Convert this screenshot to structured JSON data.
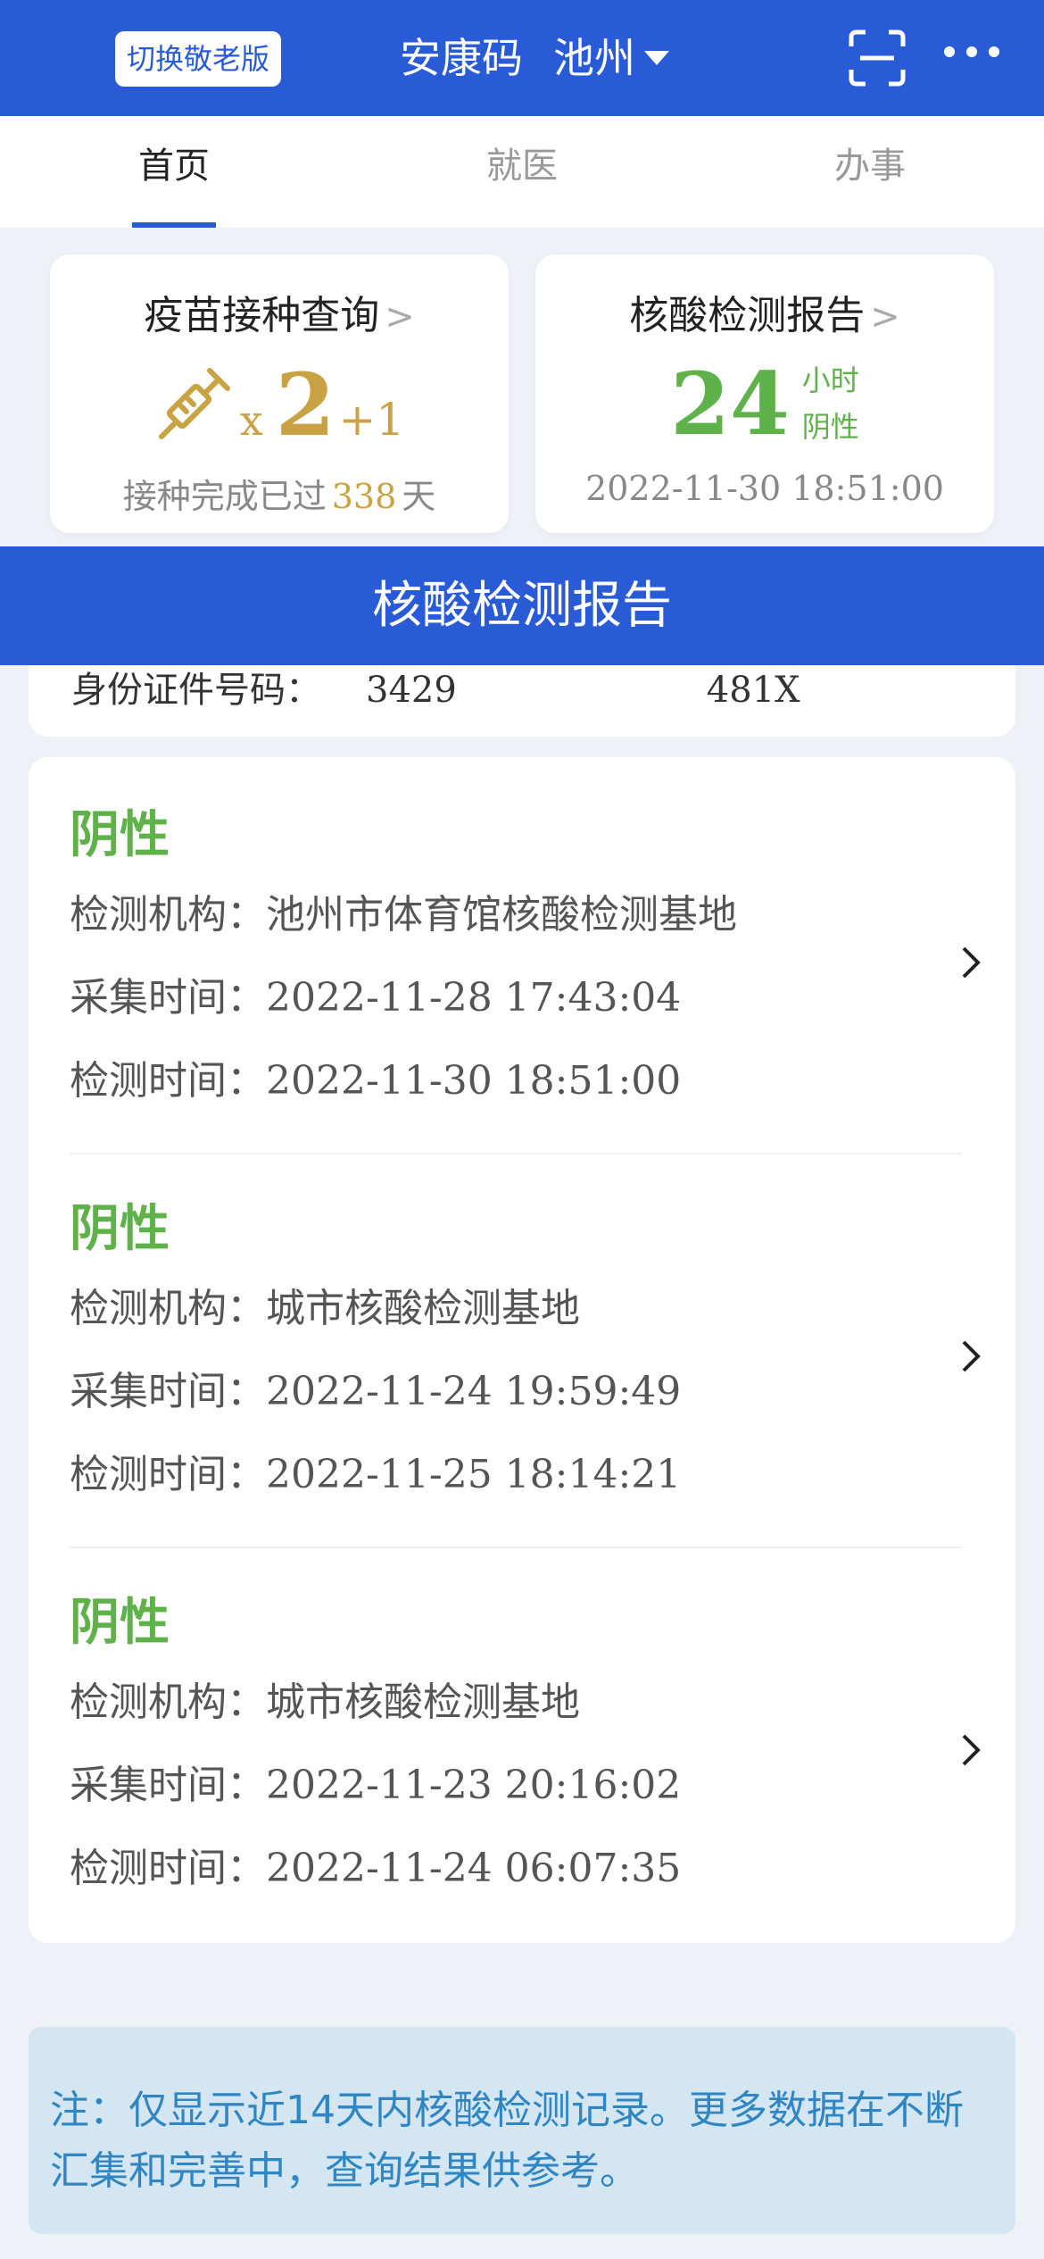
{
  "header": {
    "elder_mode_label": "切换敬老版",
    "app_title": "安康码",
    "city": "池州"
  },
  "tabs": [
    {
      "label": "首页",
      "active": true
    },
    {
      "label": "就医",
      "active": false
    },
    {
      "label": "办事",
      "active": false
    }
  ],
  "vaccine_card": {
    "title": "疫苗接种查询",
    "dose_prefix": "x",
    "doses": "2",
    "booster": "+1",
    "note_prefix": "接种完成已过",
    "days": "338",
    "note_suffix": "天"
  },
  "nat_card": {
    "title": "核酸检测报告",
    "hours": "24",
    "hours_unit": "小时",
    "status": "阴性",
    "date": "2022-11-30 18:51:00"
  },
  "banner_title": "核酸检测报告",
  "id_card": {
    "label": "身份证件号码：",
    "value_start": "3429",
    "value_end": "481X"
  },
  "records": [
    {
      "result": "阴性",
      "org_label": "检测机构：",
      "org": "池州市体育馆核酸检测基地",
      "collect_label": "采集时间：",
      "collect_time": "2022-11-28 17:43:04",
      "test_label": "检测时间：",
      "test_time": "2022-11-30 18:51:00"
    },
    {
      "result": "阴性",
      "org_label": "检测机构：",
      "org": "城市核酸检测基地",
      "collect_label": "采集时间：",
      "collect_time": "2022-11-24 19:59:49",
      "test_label": "检测时间：",
      "test_time": "2022-11-25 18:14:21"
    },
    {
      "result": "阴性",
      "org_label": "检测机构：",
      "org": "城市核酸检测基地",
      "collect_label": "采集时间：",
      "collect_time": "2022-11-23 20:16:02",
      "test_label": "检测时间：",
      "test_time": "2022-11-24 06:07:35"
    }
  ],
  "note": "注：仅显示近14天内核酸检测记录。更多数据在不断汇集和完善中，查询结果供参考。",
  "colors": {
    "brand_blue": "#2a5bd7",
    "negative_green": "#5fb149",
    "vaccine_gold": "#c9a343",
    "note_bg": "#d4e6f1",
    "note_text": "#2f86c3"
  },
  "icons": [
    "scan-icon",
    "more-icon",
    "syringe-icon",
    "chevron-right-icon",
    "caret-down-icon"
  ]
}
